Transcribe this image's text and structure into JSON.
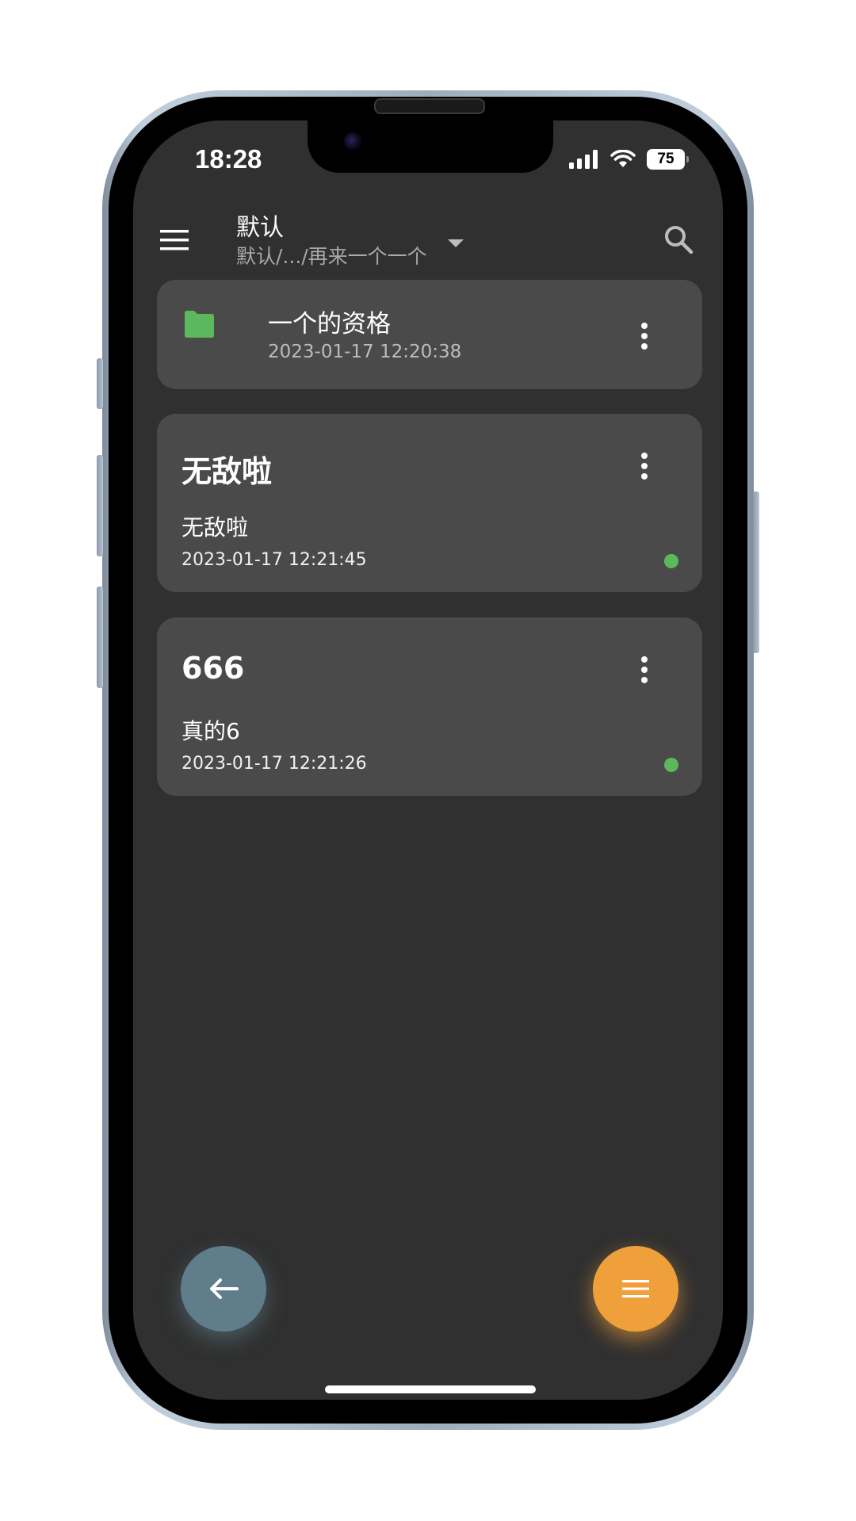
{
  "status_bar": {
    "time": "18:28",
    "battery": "75",
    "icons": [
      "signal-icon",
      "wifi-icon",
      "battery-icon"
    ]
  },
  "app_bar": {
    "title": "默认",
    "subtitle": "默认/.../再来一个一个",
    "icons": [
      "menu-icon",
      "dropdown-arrow-icon",
      "search-icon"
    ]
  },
  "items": {
    "folder": {
      "name": "一个的资格",
      "date": "2023-01-17 12:20:38",
      "icon": "folder-icon",
      "icon_color": "#5cb85c"
    },
    "notes": [
      {
        "title": "无敌啦",
        "body": "无敌啦",
        "date": "2023-01-17 12:21:45",
        "status_color": "#5cb85c"
      },
      {
        "title": "666",
        "body": "真的6",
        "date": "2023-01-17 12:21:26",
        "status_color": "#5cb85c"
      }
    ]
  },
  "fabs": {
    "back": {
      "icon": "arrow-left-icon",
      "color": "#607d8b"
    },
    "menu": {
      "icon": "menu-icon",
      "color": "#f0a03a"
    }
  },
  "colors": {
    "background": "#303030",
    "card": "#4a4a4a",
    "accent": "#f0a03a"
  }
}
